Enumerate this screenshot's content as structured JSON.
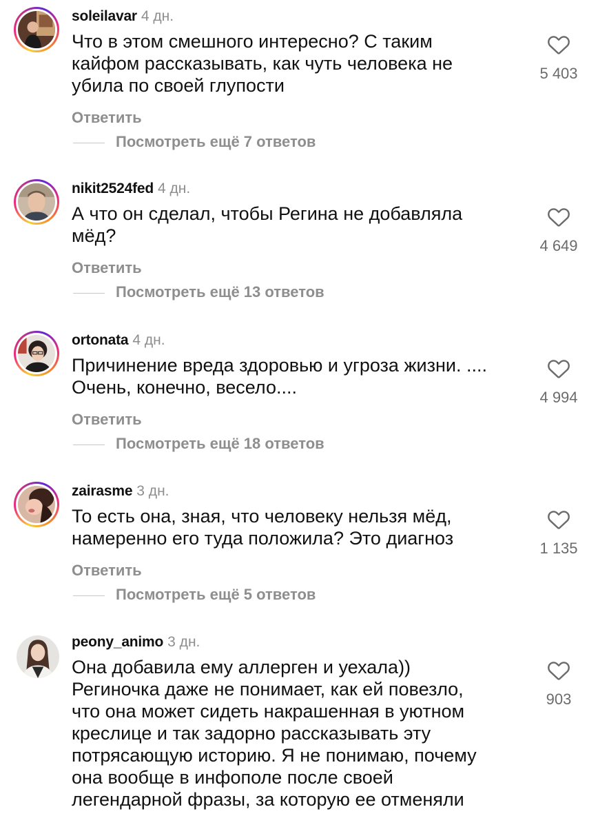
{
  "comments": [
    {
      "username": "soleilavar",
      "time": "4 дн.",
      "text": "Что в этом смешного интересно? С таким\nкайфом рассказывать, как чуть человека не\nубила по своей глупости",
      "likes": "5 403",
      "reply_label": "Ответить",
      "more_label": "Посмотреть ещё 7 ответов"
    },
    {
      "username": "nikit2524fed",
      "time": "4 дн.",
      "text": "А что он сделал, чтобы Регина не добавляла\nмёд?",
      "likes": "4 649",
      "reply_label": "Ответить",
      "more_label": "Посмотреть ещё 13 ответов"
    },
    {
      "username": "ortonata",
      "time": "4 дн.",
      "text": "Причинение вреда здоровью и угроза жизни. ....\nОчень, конечно, весело....",
      "likes": "4 994",
      "reply_label": "Ответить",
      "more_label": "Посмотреть ещё 18 ответов"
    },
    {
      "username": "zairasme",
      "time": "3 дн.",
      "text": "То есть она, зная, что человеку нельзя мёд,\nнамеренно его туда положила? Это диагноз",
      "likes": "1 135",
      "reply_label": "Ответить",
      "more_label": "Посмотреть ещё 5 ответов"
    },
    {
      "username": "peony_animo",
      "time": "3 дн.",
      "text": "Она добавила ему аллерген и уехала))\nРегиночка даже не понимает, как ей повезло,\nчто она может сидеть накрашенная в уютном\nкреслице и так задорно рассказывать эту\nпотрясающую историю. Я не понимаю, почему\nона вообще в инфополе после своей\nлегендарной фразы, за которую ее отменяли",
      "likes": "903"
    }
  ],
  "icons": {
    "like": "heart-outline-icon"
  },
  "colors": {
    "secondary_text": "#8e8e8e",
    "story_ring_start": "#f9ce34",
    "story_ring_mid": "#ee2a7b",
    "story_ring_end": "#6228d7"
  }
}
